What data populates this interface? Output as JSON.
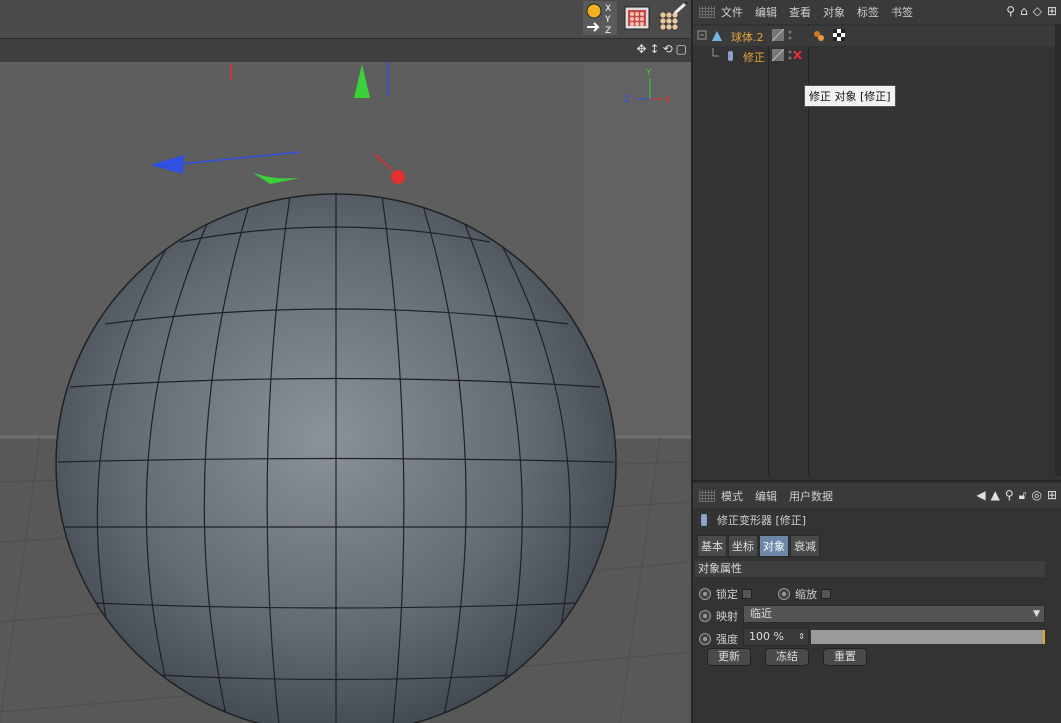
{
  "object_manager": {
    "menu": [
      "文件",
      "编辑",
      "查看",
      "对象",
      "标签",
      "书签"
    ],
    "objects": [
      {
        "name": "球体.2",
        "color": "#e8a33a"
      },
      {
        "name": "修正",
        "color": "#e8a33a"
      }
    ],
    "tooltip": "修正 对象 [修正]"
  },
  "attribute_manager": {
    "menu": [
      "模式",
      "编辑",
      "用户数据"
    ],
    "header_title": "修正变形器 [修正]",
    "tabs": [
      "基本",
      "坐标",
      "对象",
      "衰减"
    ],
    "active_tab": "对象",
    "section_title": "对象属性",
    "props": {
      "lock_label": "锁定",
      "scale_label": "缩放",
      "mapping_label": "映射",
      "mapping_value": "临近",
      "strength_label": "强度",
      "strength_value": "100 %",
      "strength_fraction": 1.0
    },
    "buttons": [
      "更新",
      "冻结",
      "重置"
    ]
  },
  "viewport": {
    "axis_labels": {
      "y": "Y",
      "z": "Z",
      "x": "X"
    }
  },
  "toolbar": {
    "axis_letters": [
      "X",
      "Y",
      "Z"
    ]
  },
  "colors": {
    "accent": "#e8a33a",
    "active_tab": "#6c86a8",
    "axis_x": "#e53030",
    "axis_y": "#3bd13b",
    "axis_z": "#3050e0"
  }
}
